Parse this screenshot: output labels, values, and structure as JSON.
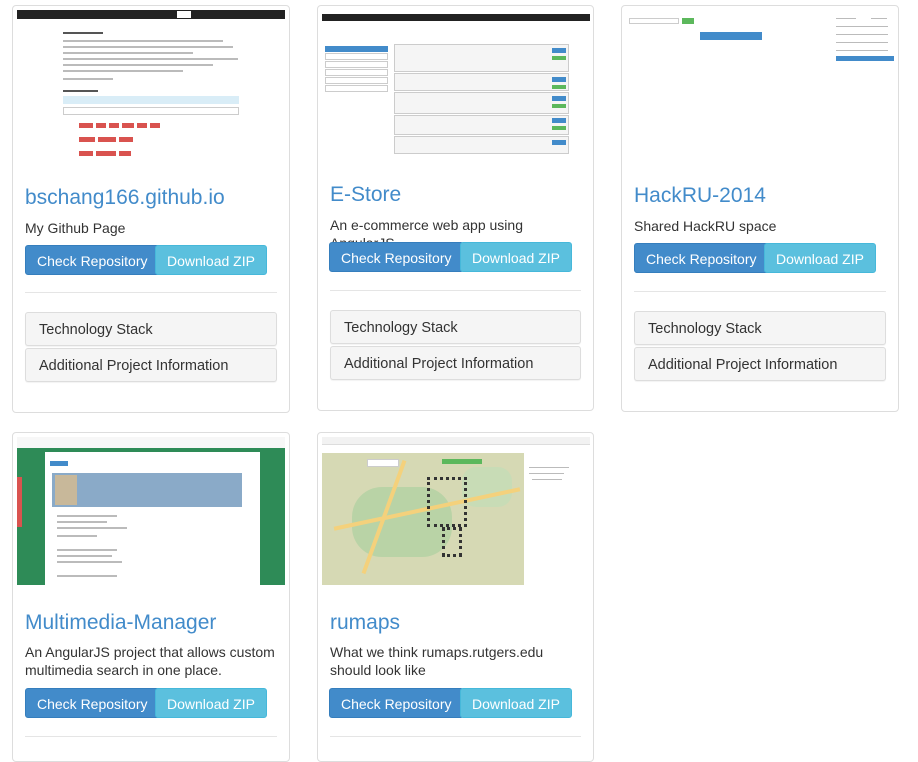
{
  "projects": [
    {
      "title": "bschang166.github.io",
      "description": "My Github Page",
      "check_label": "Check Repository",
      "download_label": "Download ZIP",
      "stack_label": "Technology Stack",
      "info_label": "Additional Project Information"
    },
    {
      "title": "E-Store",
      "description": "An e-commerce web app using AngularJS",
      "check_label": "Check Repository",
      "download_label": "Download ZIP",
      "stack_label": "Technology Stack",
      "info_label": "Additional Project Information"
    },
    {
      "title": "HackRU-2014",
      "description": "Shared HackRU space",
      "check_label": "Check Repository",
      "download_label": "Download ZIP",
      "stack_label": "Technology Stack",
      "info_label": "Additional Project Information"
    },
    {
      "title": "Multimedia-Manager",
      "description": "An AngularJS project that allows custom multimedia search in one place.",
      "check_label": "Check Repository",
      "download_label": "Download ZIP"
    },
    {
      "title": "rumaps",
      "description": "What we think rumaps.rutgers.edu should look like",
      "check_label": "Check Repository",
      "download_label": "Download ZIP"
    }
  ],
  "colors": {
    "primary": "#428bca",
    "info": "#5bc0de",
    "panel": "#f5f5f5"
  }
}
